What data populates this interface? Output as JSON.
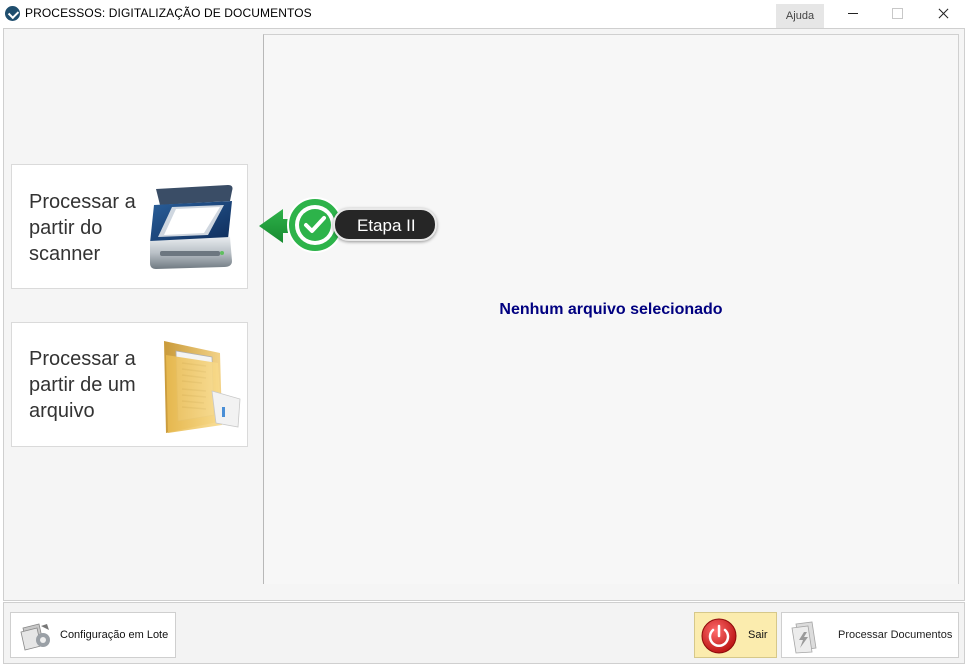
{
  "window": {
    "title": "PROCESSOS: DIGITALIZAÇÃO DE DOCUMENTOS",
    "help_label": "Ajuda",
    "icons": {
      "app": "app-logo-icon",
      "minimize": "minimize-icon",
      "maximize": "maximize-icon",
      "close": "close-icon"
    }
  },
  "options": {
    "scanner": {
      "label": "Processar a partir do scanner",
      "icon": "scanner-icon"
    },
    "file": {
      "label": "Processar a partir de um arquivo",
      "icon": "folder-icon"
    }
  },
  "step_badge": {
    "label": "Etapa II",
    "icon": "checkmark-icon",
    "accent": "#2db34a"
  },
  "preview": {
    "empty_message": "Nenhum arquivo selecionado",
    "message_color": "#000080"
  },
  "footer": {
    "config_button": {
      "label": "Configuração em Lote",
      "icon": "batch-config-icon"
    },
    "exit_button": {
      "label": "Sair",
      "icon": "power-icon",
      "background": "#fbecae"
    },
    "process_button": {
      "label": "Processar Documentos",
      "icon": "process-documents-icon"
    }
  }
}
